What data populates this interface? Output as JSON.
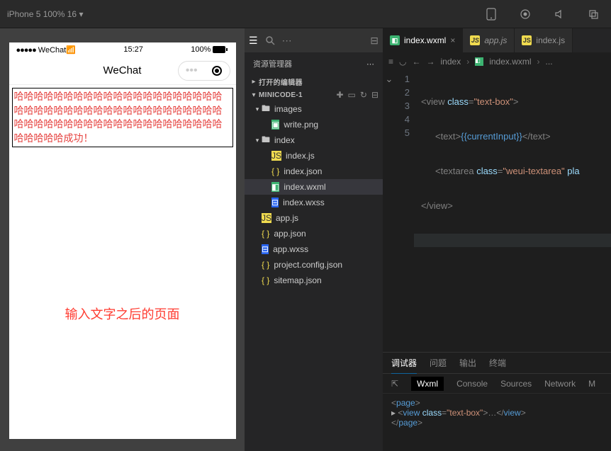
{
  "simbar": {
    "device": "iPhone 5 100% 16",
    "arrow": "▾"
  },
  "phone": {
    "status_left": "●●●●● WeChat",
    "time": "15:27",
    "battery": "100%",
    "title": "WeChat",
    "text_content": "哈哈哈哈哈哈哈哈哈哈哈哈哈哈哈哈哈哈哈哈哈哈哈哈哈哈哈哈哈哈哈哈哈哈哈哈哈哈哈哈哈哈哈哈哈哈哈哈哈哈哈哈哈哈哈哈哈哈哈哈哈哈哈哈哈哈哈哈成功！",
    "annotation": "输入文字之后的页面"
  },
  "explorer": {
    "title": "资源管理器",
    "open_editors": "打开的编辑器",
    "project": "MINICODE-1"
  },
  "tree": {
    "images": "images",
    "write_png": "write.png",
    "index": "index",
    "index_js": "index.js",
    "index_json": "index.json",
    "index_wxml": "index.wxml",
    "index_wxss": "index.wxss",
    "app_js": "app.js",
    "app_json": "app.json",
    "app_wxss": "app.wxss",
    "project_json": "project.config.json",
    "sitemap_json": "sitemap.json"
  },
  "tabs": {
    "index_wxml": "index.wxml",
    "app_js": "app.js",
    "index_js": "index.js"
  },
  "breadcrumb": {
    "a": "index",
    "b": "index.wxml",
    "c": "..."
  },
  "code": {
    "l1": {
      "tag_open": "<view",
      "attr": " class",
      "eq": "=",
      "str": "\"text-box\"",
      "close": ">"
    },
    "l2": {
      "tag_open": "<text>",
      "expr": "{{currentInput}}",
      "tag_close": "</text>"
    },
    "l3": {
      "tag_open": "<textarea",
      "attr": " class",
      "eq": "=",
      "str": "\"weui-textarea\"",
      "attr2": " pla"
    },
    "l4": {
      "tag": "</view>"
    },
    "nums": [
      "1",
      "2",
      "3",
      "4",
      "5"
    ]
  },
  "panel": {
    "tabs": {
      "debugger": "调试器",
      "problems": "问题",
      "output": "输出",
      "terminal": "终端"
    },
    "sub": {
      "wxml": "Wxml",
      "console": "Console",
      "sources": "Sources",
      "network": "Network",
      "m": "M"
    },
    "body": {
      "l1_open": "<page>",
      "l2_arrow": "▸",
      "l2_open": "<view ",
      "l2_attr": "class",
      "l2_eq": "=",
      "l2_str": "\"text-box\"",
      "l2_mid": ">…",
      "l2_close": "</view>",
      "l3_close": "</page>"
    }
  }
}
